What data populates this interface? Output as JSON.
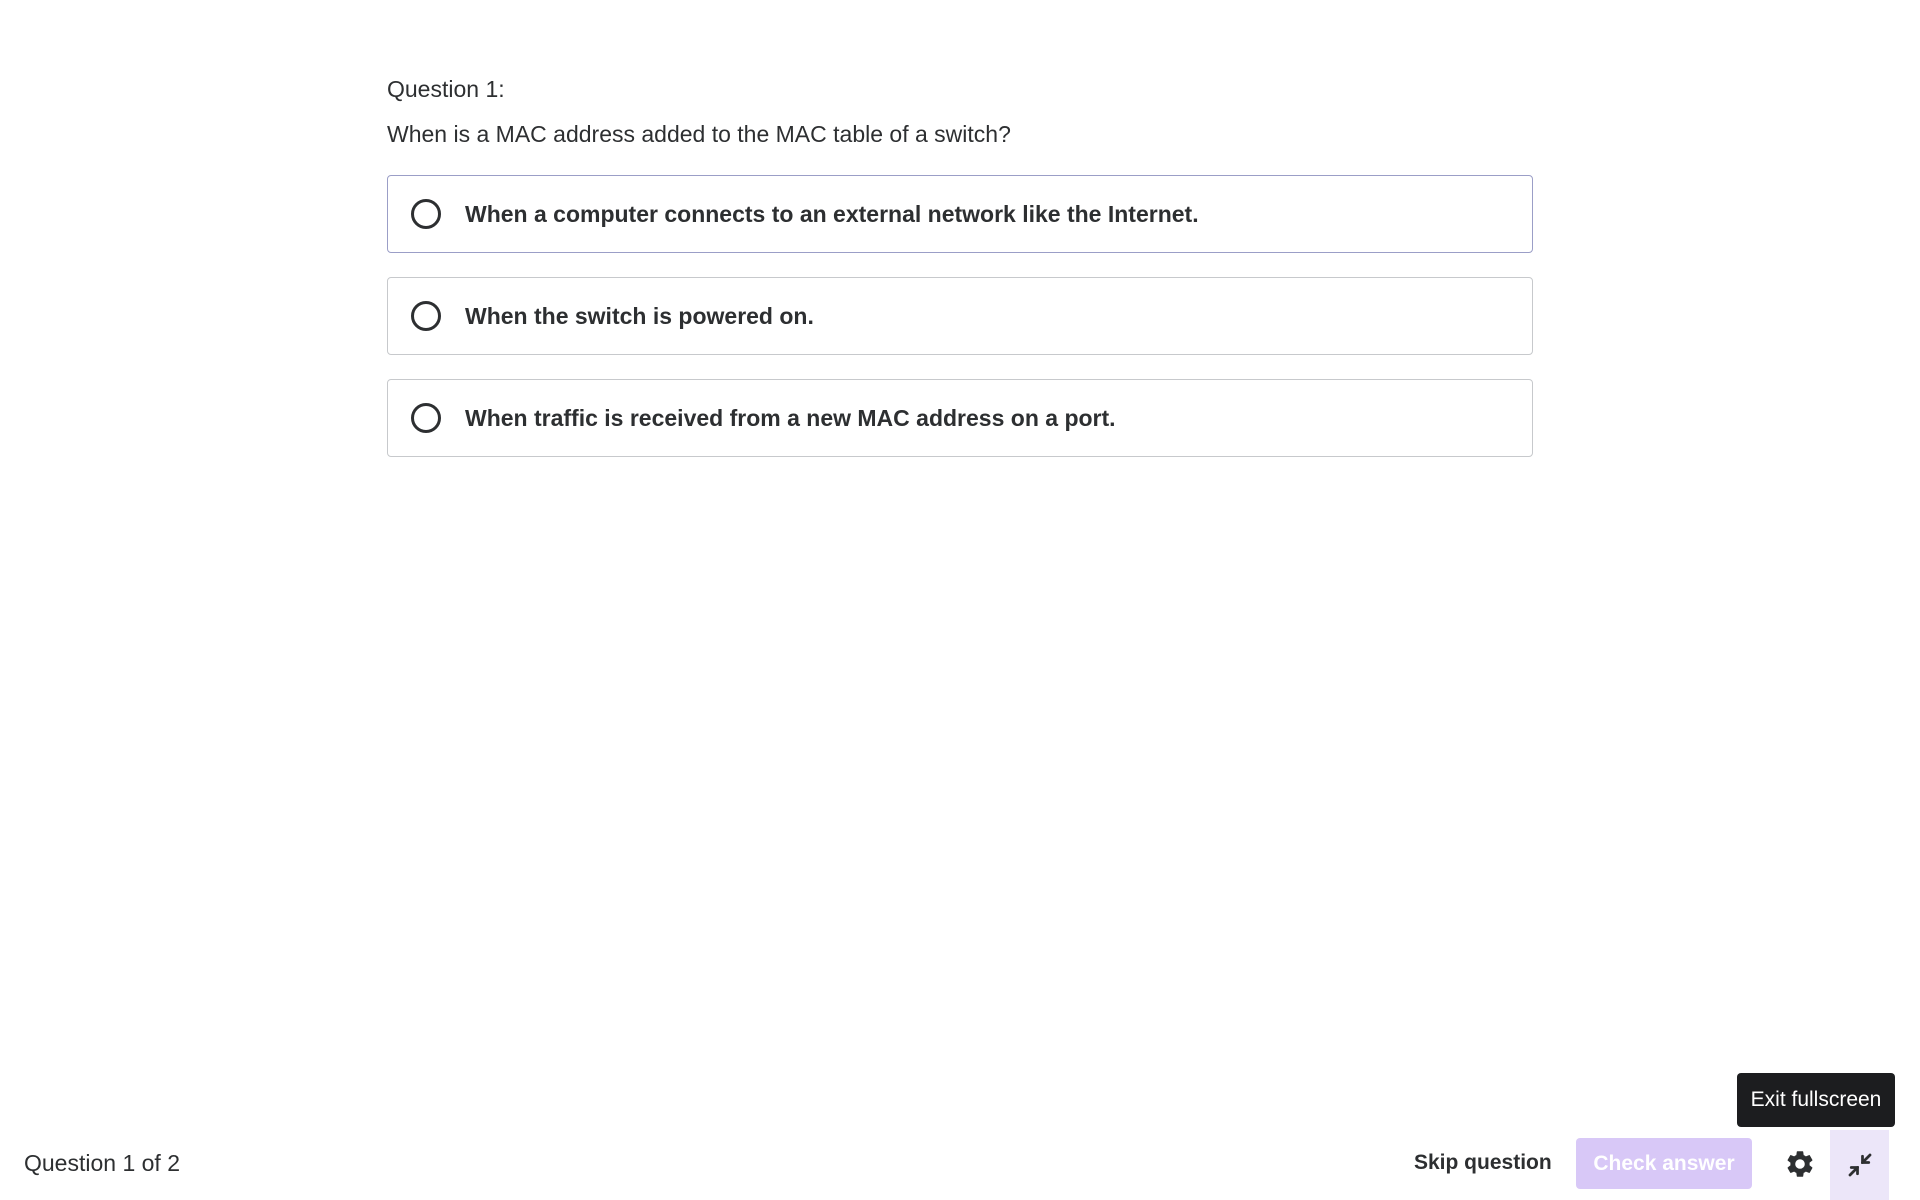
{
  "quiz": {
    "question_label": "Question 1:",
    "question_text": "When is a MAC address added to the MAC table of a switch?",
    "options": [
      {
        "label": "When a computer connects to an external network like the Internet."
      },
      {
        "label": "When the switch is powered on."
      },
      {
        "label": "When traffic is received from a new MAC address on a port."
      }
    ]
  },
  "footer": {
    "progress": "Question 1 of 2",
    "skip_label": "Skip question",
    "check_label": "Check answer",
    "settings_icon": "gear-icon",
    "exit_icon": "exit-fullscreen-icon"
  },
  "tooltip": {
    "text": "Exit fullscreen"
  },
  "colors": {
    "text": "#2d2f31",
    "check_button_disabled": "#d8c8f7",
    "exit_button_bg": "#ece6f9",
    "tooltip_bg": "#1c1d1f"
  }
}
